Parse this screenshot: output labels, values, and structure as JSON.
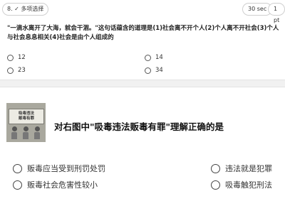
{
  "question1": {
    "type_badge": "8. ✓ 多项选择",
    "timer": "30 sec",
    "points": "1 pt",
    "text": "\"一滴水离开了大海，就会干涸。\"这句话蕴含的道理是(1)社会离不开个人(2)个人离不开社会(3)个人与社会息息相关(4)社会是由个人组成的",
    "options": [
      "12",
      "14",
      "23",
      "34"
    ]
  },
  "question2": {
    "image_sign_text": [
      "吸毒违法",
      "贩毒有罪"
    ],
    "text": "对右图中\"吸毒违法贩毒有罪\"理解正确的是",
    "options": [
      "贩毒应当受到刑罚处罚",
      "违法就是犯罪",
      "贩毒社会危害性较小",
      "吸毒触犯刑法"
    ]
  }
}
